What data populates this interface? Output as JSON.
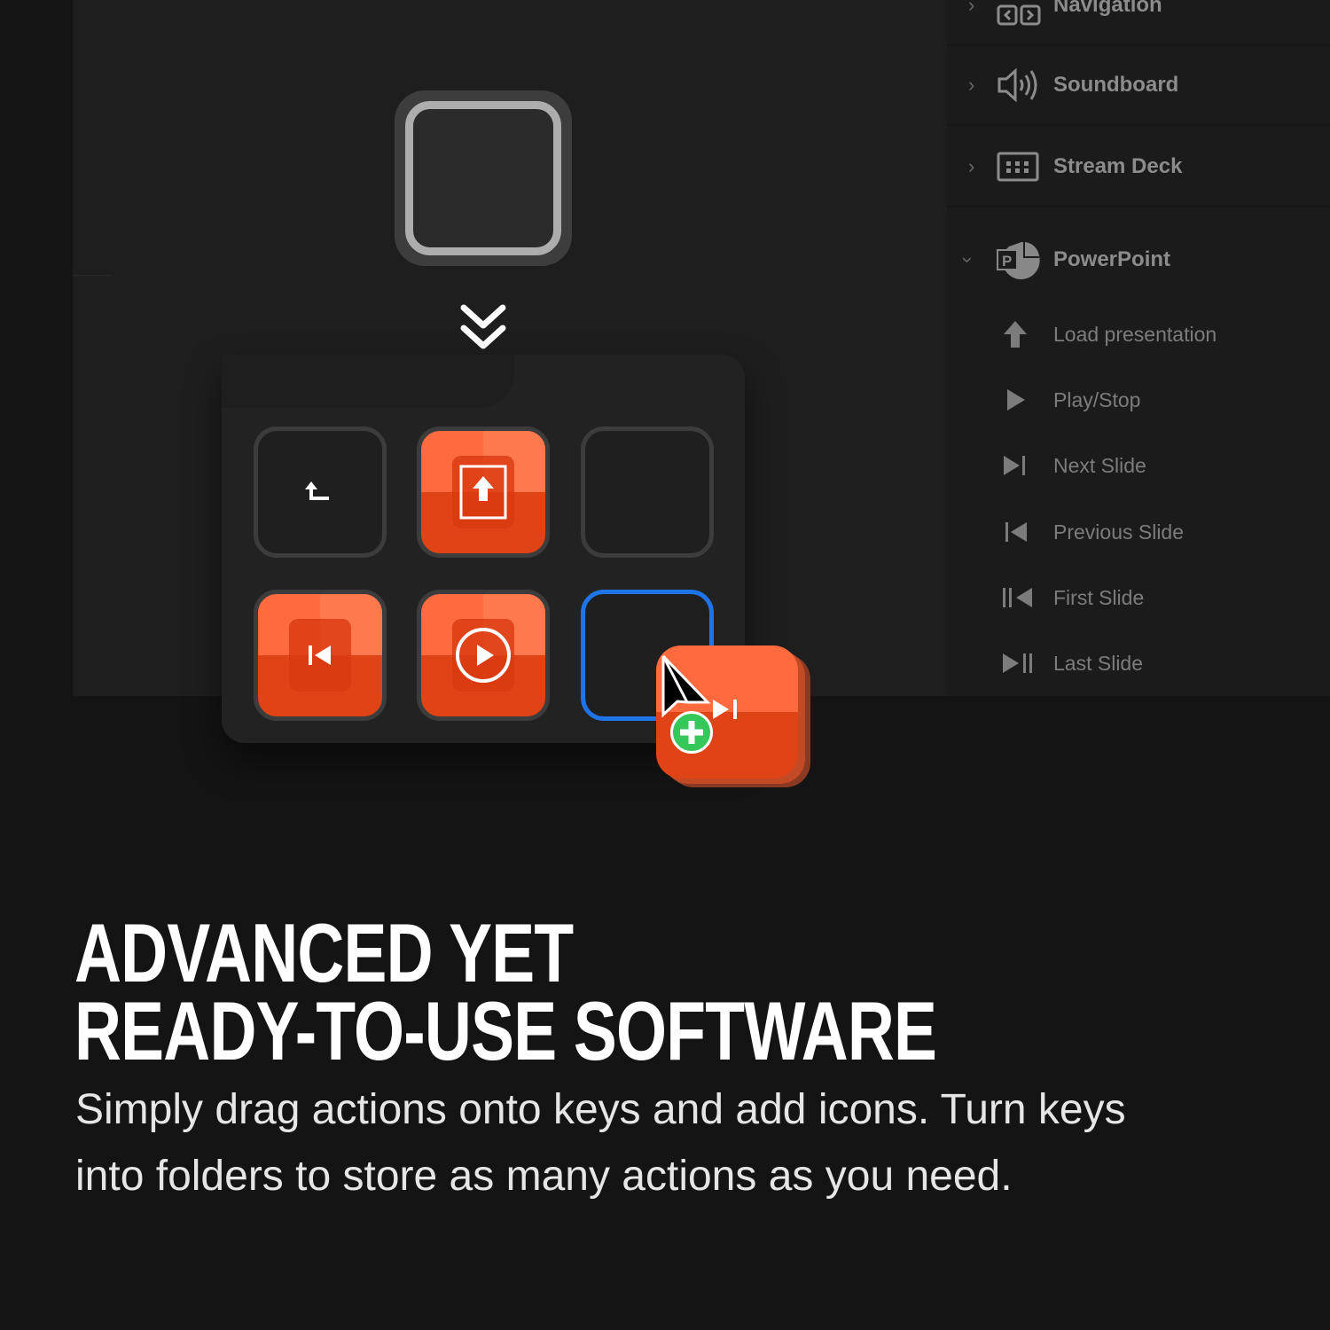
{
  "sidebar": {
    "categories": [
      {
        "label": "Navigation",
        "icon": "navigation-arrows-icon",
        "expanded": false
      },
      {
        "label": "Soundboard",
        "icon": "speaker-icon",
        "expanded": false
      },
      {
        "label": "Stream Deck",
        "icon": "stream-deck-grid-icon",
        "expanded": false
      },
      {
        "label": "PowerPoint",
        "icon": "powerpoint-icon",
        "expanded": true
      }
    ],
    "actions": [
      {
        "label": "Load presentation",
        "icon": "upload-arrow-icon"
      },
      {
        "label": "Play/Stop",
        "icon": "play-icon"
      },
      {
        "label": "Next Slide",
        "icon": "next-icon"
      },
      {
        "label": "Previous Slide",
        "icon": "previous-icon"
      },
      {
        "label": "First Slide",
        "icon": "first-icon"
      },
      {
        "label": "Last Slide",
        "icon": "last-icon"
      }
    ]
  },
  "folder": {
    "keys": [
      "back",
      "load-presentation",
      "empty",
      "previous-slide",
      "play-stop",
      "empty-selected"
    ]
  },
  "colors": {
    "accent_orange": "#e8461a",
    "selection_blue": "#1f74e8",
    "add_green": "#36c75a"
  },
  "headline": {
    "line1": "ADVANCED YET",
    "line2": "READY-TO-USE SOFTWARE"
  },
  "body": {
    "line1": "Simply drag actions onto keys and add icons. Turn keys",
    "line2": "into folders to store as many actions as you need."
  }
}
